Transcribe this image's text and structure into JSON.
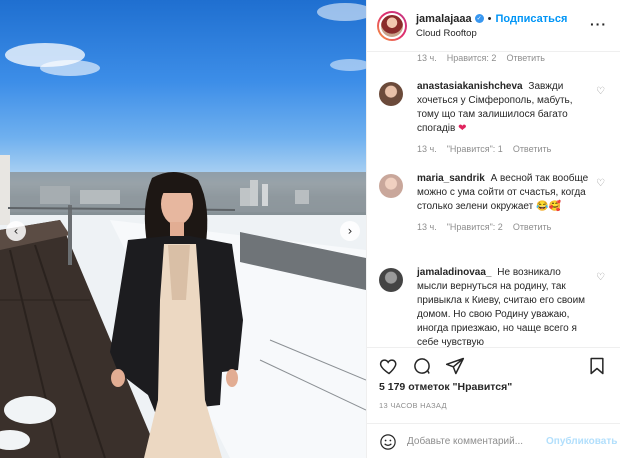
{
  "header": {
    "username": "jamalajaaa",
    "separator": "•",
    "follow_label": "Подписаться",
    "location": "Cloud Rooftop",
    "more_label": "···"
  },
  "top_meta": {
    "time": "13 ч.",
    "likes": "Нравится: 2",
    "reply": "Ответить"
  },
  "comments": [
    {
      "user": "anastasiakanishcheva",
      "text": "Завжди хочеться у Сімферополь, мабуть, тому що там залишилося багато спогадів",
      "emoji": "❤",
      "time": "13 ч.",
      "likes": "\"Нравится\": 1",
      "reply": "Ответить",
      "avatar_color": "#6b4a3a"
    },
    {
      "user": "maria_sandrik",
      "text": "А весной так вообще можно с ума сойти от счастья, когда столько зелени окружает",
      "emoji": "😂🥰",
      "time": "13 ч.",
      "likes": "\"Нравится\": 2",
      "reply": "Ответить",
      "avatar_color": "#c9a79b"
    },
    {
      "user": "jamaladinovaa_",
      "text": "Не возникало мысли вернуться на родину, так привыкла к Киеву, считаю его своим домом. Но свою Родину уважаю, иногда приезжаю, но чаще всего я себе чувствую",
      "emoji": "",
      "time": "",
      "likes": "",
      "reply": "",
      "avatar_color": "#444444"
    }
  ],
  "footer": {
    "likes_text": "5 179 отметок \"Нравится\"",
    "time_text": "13 ЧАСОВ НАЗАД",
    "comment_placeholder": "Добавьте комментарий...",
    "publish_label": "Опубликовать"
  },
  "photo": {
    "prev_arrow": "‹",
    "next_arrow": "›"
  },
  "colors": {
    "accent": "#0095f6",
    "verified": "#3897f0",
    "muted": "#8e8e8e",
    "heart": "#e0245e"
  }
}
